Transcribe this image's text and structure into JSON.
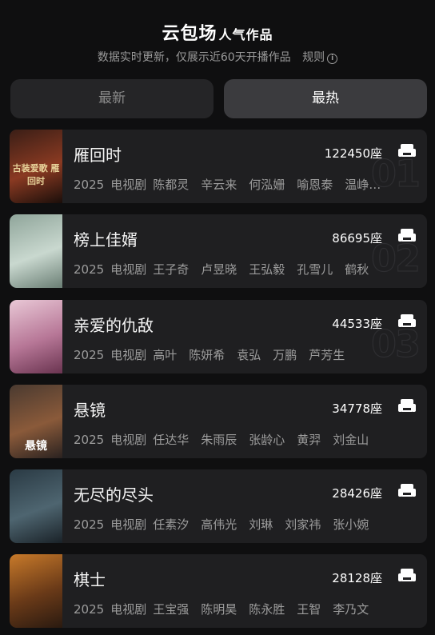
{
  "header": {
    "title_main": "云包场",
    "title_sub": "人气作品",
    "subtitle": "数据实时更新，仅展示近60天开播作品",
    "rules_label": "规则",
    "info_icon": "i"
  },
  "tabs": [
    {
      "label": "最新",
      "selected": false
    },
    {
      "label": "最热",
      "selected": true
    }
  ],
  "items": [
    {
      "title": "雁回时",
      "seats": "122450座",
      "year": "2025",
      "category": "电视剧",
      "cast_text": "陈都灵　辛云来　何泓姗　喻恩泰　温峥…",
      "rank": "01",
      "poster_text": "古装爱歌 雁回时",
      "poster_colors": [
        "#3a1e16",
        "#8a3a22",
        "#1a0e0a"
      ]
    },
    {
      "title": "榜上佳婿",
      "seats": "86695座",
      "year": "2025",
      "category": "电视剧",
      "cast_text": "王子奇　卢昱晓　王弘毅　孔雪儿　鹤秋",
      "rank": "02",
      "poster_text": "",
      "poster_colors": [
        "#8fa59a",
        "#c9d8cf",
        "#6a7e74"
      ]
    },
    {
      "title": "亲爱的仇敌",
      "seats": "44533座",
      "year": "2025",
      "category": "电视剧",
      "cast_text": "高叶　陈妍希　袁弘　万鹏　芦芳生",
      "rank": "03",
      "poster_text": "",
      "poster_colors": [
        "#e9c8d6",
        "#b77797",
        "#6a3450"
      ]
    },
    {
      "title": "悬镜",
      "seats": "34778座",
      "year": "2025",
      "category": "电视剧",
      "cast_text": "任达华　朱雨辰　张龄心　黄羿　刘金山",
      "rank": "",
      "poster_text": "悬镜",
      "poster_colors": [
        "#4a3a30",
        "#8a5a3a",
        "#2a2220"
      ]
    },
    {
      "title": "无尽的尽头",
      "seats": "28426座",
      "year": "2025",
      "category": "电视剧",
      "cast_text": "任素汐　高伟光　刘琳　刘家祎　张小婉",
      "rank": "",
      "poster_text": "",
      "poster_colors": [
        "#2a3a44",
        "#4e6570",
        "#1a2228"
      ]
    },
    {
      "title": "棋士",
      "seats": "28128座",
      "year": "2025",
      "category": "电视剧",
      "cast_text": "王宝强　陈明昊　陈永胜　王智　李乃文",
      "rank": "",
      "poster_text": "",
      "poster_colors": [
        "#c87a2a",
        "#6a3a18",
        "#2a1a10"
      ]
    }
  ],
  "colors": {
    "background": "#0f0f10",
    "card": "#1f1f21",
    "tab_inactive": "#252527",
    "tab_active": "#3b3b3e",
    "muted_text": "#9c9c9c"
  }
}
